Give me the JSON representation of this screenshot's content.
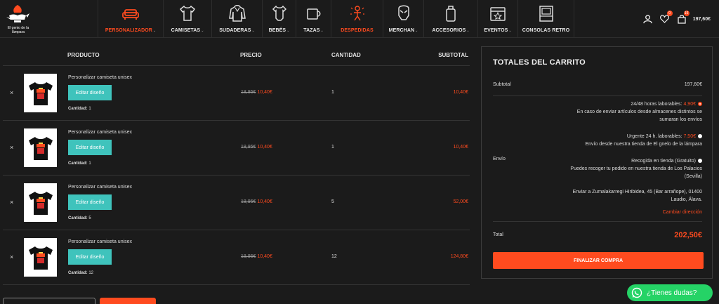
{
  "brand": {
    "logo_text": "El genio de la lámpara"
  },
  "nav": {
    "items": [
      {
        "label": "PERSONALIZADOR",
        "icon": "sofa-icon",
        "chevron": true,
        "accent": true
      },
      {
        "label": "CAMISETAS",
        "icon": "tshirt-icon",
        "chevron": true,
        "accent": false
      },
      {
        "label": "SUDADERAS",
        "icon": "hoodie-icon",
        "chevron": true,
        "accent": false
      },
      {
        "label": "BEBÉS",
        "icon": "onesie-icon",
        "chevron": true,
        "accent": false
      },
      {
        "label": "TAZAS",
        "icon": "mug-icon",
        "chevron": true,
        "accent": false
      },
      {
        "label": "DESPEDIDAS",
        "icon": "party-icon",
        "chevron": false,
        "accent": true
      },
      {
        "label": "MERCHAN",
        "icon": "helmet-icon",
        "chevron": true,
        "accent": false
      },
      {
        "label": "ACCESORIOS",
        "icon": "bag-icon",
        "chevron": true,
        "accent": false
      },
      {
        "label": "EVENTOS",
        "icon": "calendar-icon",
        "chevron": true,
        "accent": false
      },
      {
        "label": "CONSOLAS RETRO",
        "icon": "arcade-icon",
        "chevron": false,
        "accent": false
      }
    ],
    "chevron_glyph": "⌄",
    "wishlist_count": "0",
    "cart_count": "16",
    "cart_total": "197,60€"
  },
  "table": {
    "headers": {
      "product": "PRODUCTO",
      "price": "PRECIO",
      "qty": "CANTIDAD",
      "subtotal": "SUBTOTAL"
    },
    "remove_glyph": "×",
    "rows": [
      {
        "name": "Personalizar camiseta unisex",
        "edit_label": "Editar diseño",
        "qty_label": "Cantidad:",
        "qty_small": "1",
        "old_price": "18,95€",
        "new_price": "10,40€",
        "qty": "1",
        "subtotal": "10,40€"
      },
      {
        "name": "Personalizar camiseta unisex",
        "edit_label": "Editar diseño",
        "qty_label": "Cantidad:",
        "qty_small": "1",
        "old_price": "18,95€",
        "new_price": "10,40€",
        "qty": "1",
        "subtotal": "10,40€"
      },
      {
        "name": "Personalizar camiseta unisex",
        "edit_label": "Editar diseño",
        "qty_label": "Cantidad:",
        "qty_small": "5",
        "old_price": "18,95€",
        "new_price": "10,40€",
        "qty": "5",
        "subtotal": "52,00€"
      },
      {
        "name": "Personalizar camiseta unisex",
        "edit_label": "Editar diseño",
        "qty_label": "Cantidad:",
        "qty_small": "12",
        "old_price": "18,95€",
        "new_price": "10,40€",
        "qty": "12",
        "subtotal": "124,80€"
      }
    ]
  },
  "totals": {
    "title": "TOTALES DEL CARRITO",
    "subtotal_label": "Subtotal",
    "subtotal_value": "197,60€",
    "shipping_label": "Envío",
    "options": [
      {
        "label": "24/48 horas laborables:",
        "amount": "4,90€",
        "note_1": "En caso de enviar artículos desde almacenes distintos se",
        "note_2": "sumaran los envíos",
        "checked": true
      },
      {
        "label": "Urgente 24 h. laborables:",
        "amount": "7,50€",
        "note_1": "Envío desde nuestra tienda de El gnelo de la lámpara",
        "note_2": "",
        "checked": false
      },
      {
        "label": "Recogida en tienda (Gratuito)",
        "amount": "",
        "note_1": "Puedes recoger tu pedido en nuestra tienda de Los Palacios",
        "note_2": "(Sevilla)",
        "checked": false
      }
    ],
    "ship_to_1": "Enviar a Zumalakarregi Hiribidea, 45 (Bar arrañope), 01400",
    "ship_to_2": "Laudio, Álava.",
    "change_address": "Cambiar dirección",
    "total_label": "Total",
    "total_value": "202,50€",
    "checkout_label": "FINALIZAR COMPRA"
  },
  "whatsapp": {
    "label": "¿Tienes dudas?"
  },
  "colors": {
    "accent": "#ff4b1f",
    "teal": "#3fc3bc",
    "background": "#1b1b1b",
    "whatsapp": "#25d366"
  }
}
